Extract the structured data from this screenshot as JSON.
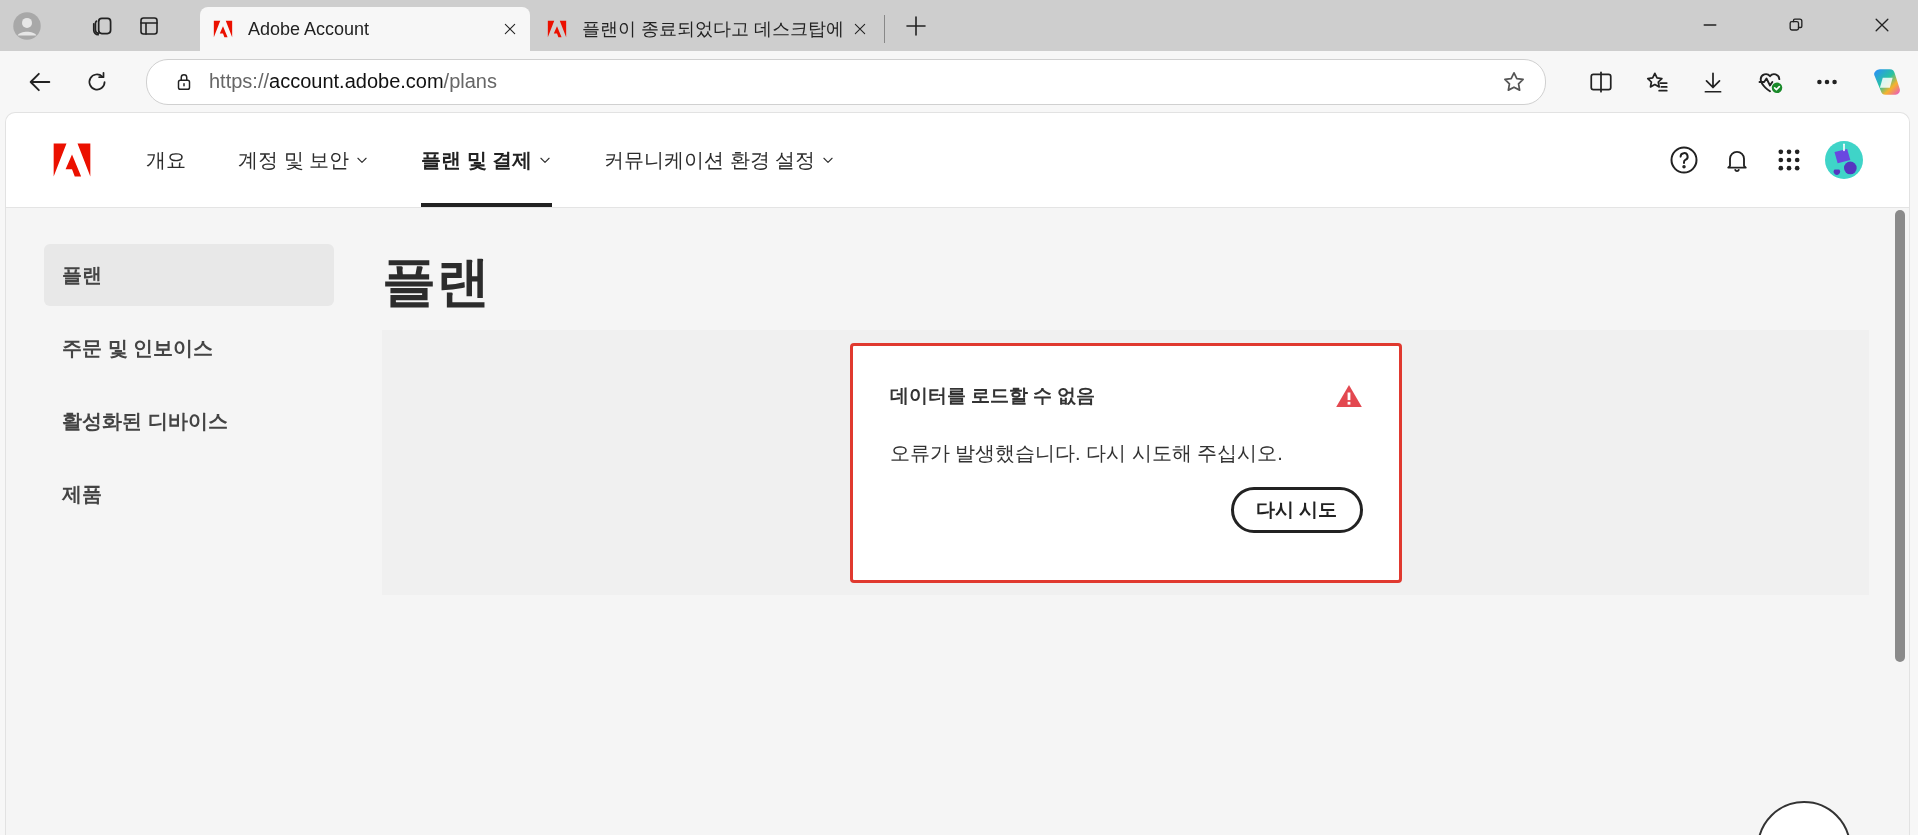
{
  "browser": {
    "tabs": [
      {
        "title": "Adobe Account",
        "selected": true
      },
      {
        "title": "플랜이 종료되었다고 데스크탑에",
        "selected": false
      }
    ],
    "address": {
      "scheme": "https://",
      "host": "account.adobe.com",
      "path": "/plans"
    }
  },
  "nav": {
    "items": [
      {
        "label": "개요",
        "selected": false,
        "dropdown": false
      },
      {
        "label": "계정 및 보안",
        "selected": false,
        "dropdown": true
      },
      {
        "label": "플랜 및 결제",
        "selected": true,
        "dropdown": true
      },
      {
        "label": "커뮤니케이션 환경 설정",
        "selected": false,
        "dropdown": true
      }
    ]
  },
  "sidebar": {
    "items": [
      {
        "label": "플랜",
        "selected": true
      },
      {
        "label": "주문 및 인보이스",
        "selected": false
      },
      {
        "label": "활성화된 디바이스",
        "selected": false
      },
      {
        "label": "제품",
        "selected": false
      }
    ]
  },
  "page_title": "플랜",
  "error_card": {
    "title": "데이터를 로드할 수 없음",
    "message": "오류가 발생했습니다. 다시 시도해 주십시오.",
    "button": "다시 시도"
  }
}
